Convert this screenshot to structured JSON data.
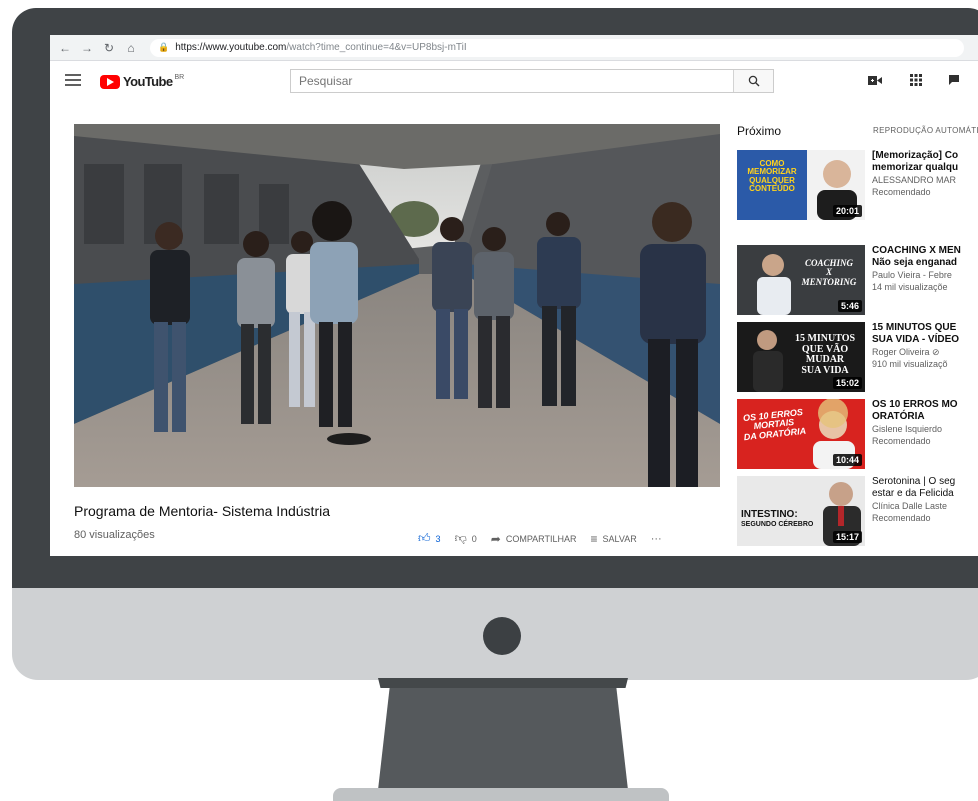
{
  "browser": {
    "url_host": "https://www.youtube.com",
    "url_rest": "/watch?time_continue=4&v=UP8bsj-mTiI"
  },
  "masthead": {
    "logo_text": "YouTube",
    "logo_country": "BR",
    "search_placeholder": "Pesquisar"
  },
  "video": {
    "title": "Programa de Mentoria- Sistema Indústria",
    "views": "80 visualizações",
    "likes": "3",
    "dislikes": "0",
    "share_label": "COMPARTILHAR",
    "save_label": "SALVAR",
    "more_label": "···"
  },
  "sidebar": {
    "next_label": "Próximo",
    "autoplay_label": "REPRODUÇÃO AUTOMÁTICA",
    "items": [
      {
        "title_line1": "[Memorização] Co",
        "title_line2": "memorizar qualqu",
        "channel": "ALESSANDRO MAR",
        "meta": "Recomendado",
        "duration": "20:01",
        "thumb_text": [
          "COMO",
          "MEMORIZAR",
          "QUALQUER",
          "CONTEÚDO"
        ],
        "thumb_color": "#2b5aa8"
      },
      {
        "title_line1": "COACHING X MEN",
        "title_line2": "Não seja enganad",
        "channel": "Paulo Vieira - Febre",
        "meta": "14 mil visualizaçõe",
        "duration": "5:46",
        "thumb_text": [
          "COACHING",
          "X",
          "MENTORING"
        ],
        "thumb_color": "#3a3d40"
      },
      {
        "title_line1": "15 MINUTOS QUE",
        "title_line2": "SUA VIDA - VÍDEO",
        "channel": "Roger Oliveira ⊘",
        "meta": "910 mil visualizaçõ",
        "duration": "15:02",
        "thumb_text": [
          "15 MINUTOS",
          "QUE VÃO",
          "MUDAR",
          "SUA VIDA"
        ],
        "thumb_color": "#1a1a1a"
      },
      {
        "title_line1": "OS 10 ERROS MO",
        "title_line2": "ORATÓRIA",
        "channel": "Gislene Isquierdo",
        "meta": "Recomendado",
        "duration": "10:44",
        "thumb_text": [
          "OS 10 ERROS",
          "MORTAIS",
          "DA ORATÓRIA"
        ],
        "thumb_color": "#d8231f"
      },
      {
        "title_line1": "Serotonina | O seg",
        "title_line2": "estar e da Felicida",
        "channel": "Clínica Dalle Laste",
        "meta": "Recomendado",
        "duration": "15:17",
        "thumb_text": [
          "INTESTINO:",
          "SEGUNDO CÉREBRO"
        ],
        "thumb_color": "#e9e9e9"
      }
    ]
  },
  "colors": {
    "bezel": "#3f4346",
    "chin": "#cfd1d3",
    "youtube_red": "#ff0000",
    "like_blue": "#065fd4"
  },
  "icons": [
    "back-arrow-icon",
    "forward-arrow-icon",
    "reload-icon",
    "home-icon",
    "lock-icon",
    "hamburger-menu-icon",
    "search-icon",
    "video-camera-icon",
    "apps-grid-icon",
    "chat-icon",
    "thumbs-up-icon",
    "thumbs-down-icon",
    "share-icon",
    "save-playlist-icon",
    "more-icon"
  ]
}
